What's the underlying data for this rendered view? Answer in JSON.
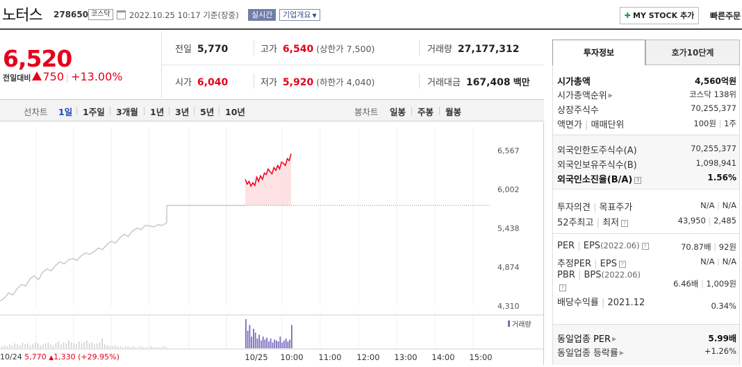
{
  "header": {
    "name": "노터스",
    "code": "278650",
    "market": "코스닥",
    "datetime": "2022.10.25 10:17 기준(장중)",
    "realtime": "실시간",
    "company_info": "기업개요",
    "mystock": "MY STOCK 추가",
    "quick_order": "빠른주문"
  },
  "price": {
    "current": "6,520",
    "change_label": "전일대비",
    "change": "750",
    "change_pct": "+13.00%"
  },
  "quote": {
    "prev_label": "전일",
    "prev": "5,770",
    "high_label": "고가",
    "high": "6,540",
    "upper_label": "(상한가",
    "upper": "7,500)",
    "volume_label": "거래량",
    "volume": "27,177,312",
    "open_label": "시가",
    "open": "6,040",
    "low_label": "저가",
    "low": "5,920",
    "lower_label": "(하한가",
    "lower": "4,040)",
    "amount_label": "거래대금",
    "amount": "167,408",
    "amount_unit": "백만"
  },
  "chart_tabs": {
    "line_label": "선차트",
    "line": [
      "1일",
      "1주일",
      "3개월",
      "1년",
      "3년",
      "5년",
      "10년"
    ],
    "candle_label": "봉차트",
    "candle": [
      "일봉",
      "주봉",
      "월봉"
    ]
  },
  "chart_data": {
    "type": "line",
    "y_ticks": [
      "6,567",
      "6,002",
      "5,438",
      "4,874",
      "4,310"
    ],
    "ylim": [
      4310,
      6567
    ],
    "prev_close": 5770,
    "x_ticks": [
      "10/24",
      "10/25",
      "10:00",
      "11:00",
      "12:00",
      "13:00",
      "14:00",
      "15:00"
    ],
    "volume_legend": "거래량",
    "prev_day": {
      "date": "10/24",
      "close": "5,770",
      "change": "1,330",
      "change_pct": "(+29.95%)"
    },
    "series": [
      {
        "day": "10/24",
        "values": [
          4380,
          4420,
          4500,
          4470,
          4560,
          4620,
          4600,
          4700,
          4750,
          4690,
          4800,
          4850,
          4820,
          4900,
          4950,
          4920,
          4980,
          5000,
          4970,
          5040,
          5080,
          5060,
          5100,
          5150,
          5130,
          5200,
          5250,
          5220,
          5300,
          5350,
          5320,
          5400,
          5440,
          5420,
          5480,
          5470,
          5460,
          5490,
          5480,
          5520,
          5770,
          5770,
          5770,
          5770,
          5770,
          5770,
          5770,
          5770,
          5770,
          5770,
          5770,
          5770,
          5770,
          5770,
          5770,
          5770,
          5770,
          5770,
          5770,
          5770,
          5770,
          5770,
          5770,
          5770,
          5770
        ]
      },
      {
        "day": "10/25",
        "values": [
          6150,
          6080,
          6120,
          6050,
          6100,
          6060,
          6180,
          6120,
          6200,
          6150,
          6240,
          6220,
          6300,
          6260,
          6230,
          6320,
          6280,
          6350,
          6300,
          6400,
          6380,
          6350,
          6450,
          6420,
          6520
        ]
      }
    ],
    "volume_day1": [
      2,
      3,
      2,
      4,
      3,
      5,
      4,
      3,
      6,
      4,
      5,
      3,
      4,
      6,
      5,
      3,
      4,
      5,
      6,
      4,
      3,
      5,
      7,
      4,
      6,
      5,
      8,
      6,
      5,
      4,
      7,
      5,
      6,
      8,
      5,
      6,
      4,
      5,
      6,
      10,
      4,
      3,
      2,
      2,
      3,
      2,
      2,
      1,
      2,
      2,
      1,
      2,
      1,
      1,
      2,
      1,
      1,
      1,
      2,
      1,
      1,
      1,
      1,
      2,
      1
    ],
    "volume_day2": [
      30,
      18,
      24,
      12,
      20,
      16,
      10,
      14,
      8,
      12,
      9,
      11,
      7,
      10,
      6,
      9,
      8,
      7,
      12,
      6,
      8,
      10,
      7,
      9,
      24
    ]
  },
  "info": {
    "tab_invest": "투자정보",
    "tab_hoga": "호가10단계",
    "market_cap_label": "시가총액",
    "market_cap": "4,560억원",
    "cap_rank_label": "시가총액순위",
    "cap_rank": "코스닥 138위",
    "shares_label": "상장주식수",
    "shares": "70,255,377",
    "par_label": "액면가",
    "trade_unit_label": "매매단위",
    "par": "100원",
    "trade_unit": "1주",
    "foreign_limit_label": "외국인한도주식수(A)",
    "foreign_limit": "70,255,377",
    "foreign_hold_label": "외국인보유주식수(B)",
    "foreign_hold": "1,098,941",
    "foreign_ratio_label": "외국인소진율(B/A)",
    "foreign_ratio": "1.56%",
    "opinion_label": "투자의견",
    "target_label": "목표주가",
    "opinion": "N/A",
    "target": "N/A",
    "high52_label": "52주최고",
    "low52_label": "최저",
    "high52": "43,950",
    "low52": "2,485",
    "per_label": "PER",
    "eps_label": "EPS",
    "eps_year": "(2022.06)",
    "per": "70.87배",
    "eps": "92원",
    "est_per_label": "추정PER",
    "est_eps_label": "EPS",
    "est_per": "N/A",
    "est_eps": "N/A",
    "pbr_label": "PBR",
    "bps_label": "BPS",
    "bps_year": "(2022.06)",
    "pbr": "6.46배",
    "bps": "1,009원",
    "div_label": "배당수익률",
    "div_year": "2021.12",
    "div": "0.34%",
    "sector_per_label": "동일업종 PER",
    "sector_per": "5.99배",
    "sector_chg_label": "동일업종 등락률",
    "sector_chg": "+1.26%"
  }
}
